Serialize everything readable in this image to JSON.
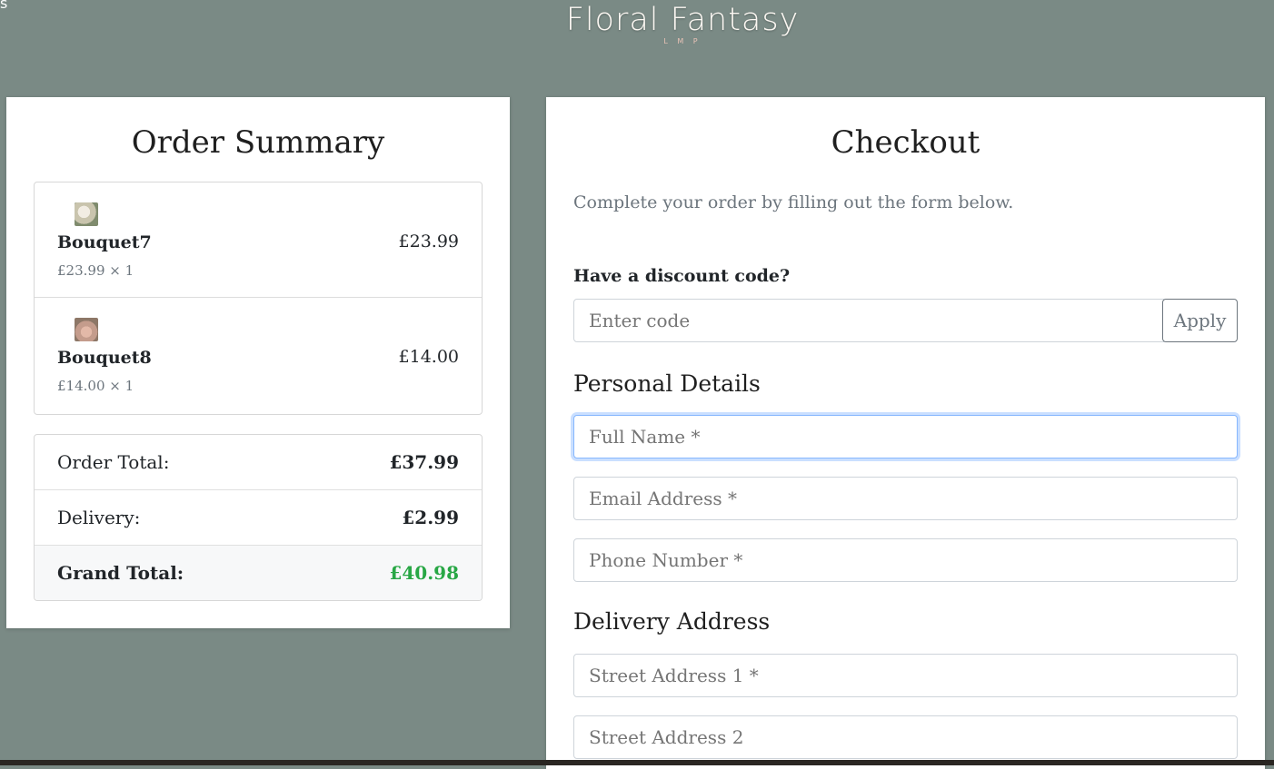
{
  "header": {
    "corner_text": "s",
    "logo_title": "Floral Fantasy",
    "logo_subtitle": "L M P"
  },
  "order_summary": {
    "title": "Order Summary",
    "items": [
      {
        "name": "Bouquet7",
        "price": "£23.99",
        "meta": "£23.99 × 1",
        "thumb_icon": "bouquet-thumbnail"
      },
      {
        "name": "Bouquet8",
        "price": "£14.00",
        "meta": "£14.00 × 1",
        "thumb_icon": "bouquet-thumbnail"
      }
    ],
    "totals": {
      "order_total_label": "Order Total:",
      "order_total_value": "£37.99",
      "delivery_label": "Delivery:",
      "delivery_value": "£2.99",
      "grand_total_label": "Grand Total:",
      "grand_total_value": "£40.98",
      "grand_total_color": "#28a745"
    }
  },
  "checkout": {
    "title": "Checkout",
    "intro": "Complete your order by filling out the form below.",
    "discount": {
      "label": "Have a discount code?",
      "placeholder": "Enter code",
      "value": "",
      "apply_label": "Apply"
    },
    "personal_heading": "Personal Details",
    "personal_fields": {
      "full_name_placeholder": "Full Name *",
      "email_placeholder": "Email Address *",
      "phone_placeholder": "Phone Number *"
    },
    "delivery_heading": "Delivery Address",
    "delivery_fields": {
      "street1_placeholder": "Street Address 1 *",
      "street2_placeholder": "Street Address 2"
    }
  },
  "colors": {
    "background": "#7a8a85",
    "accent_focus": "#86b7fe"
  }
}
